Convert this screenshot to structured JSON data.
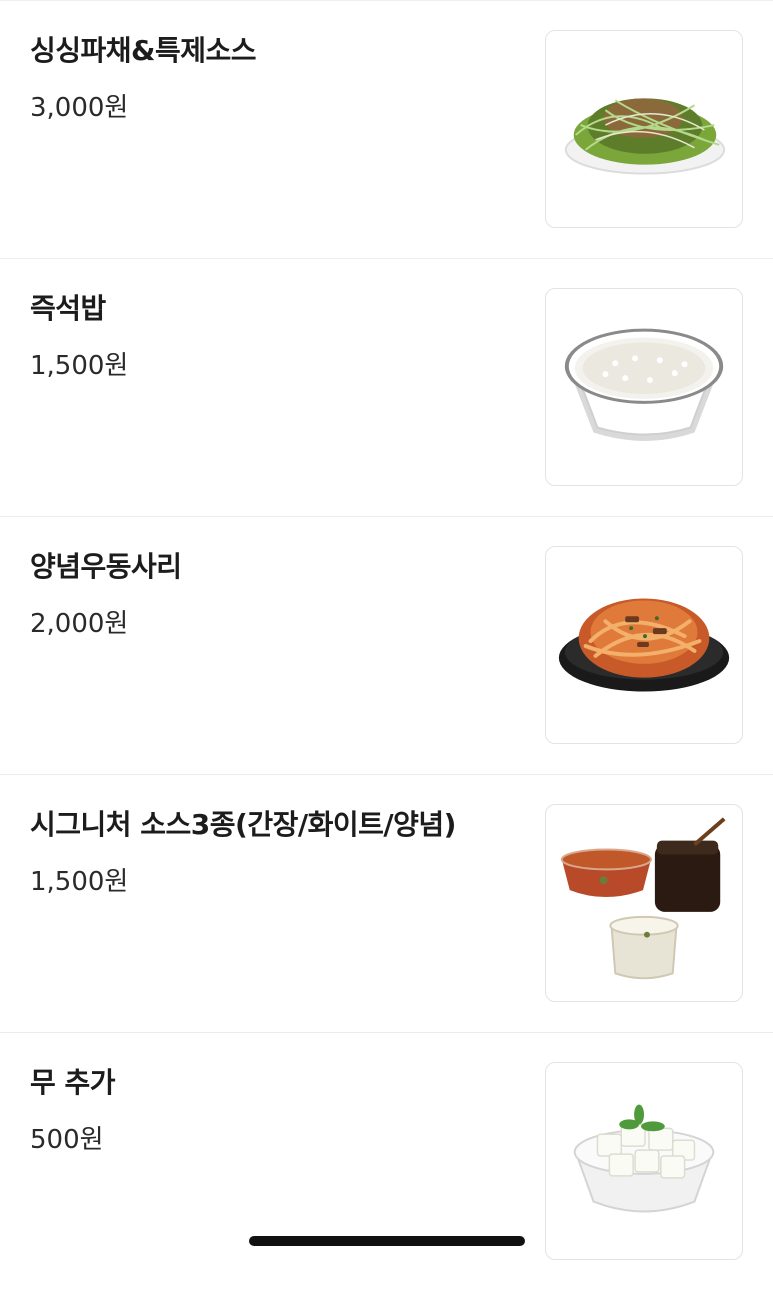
{
  "items": [
    {
      "name": "싱싱파채&특제소스",
      "price": "3,000원",
      "image": "green-onion-salad-image"
    },
    {
      "name": "즉석밥",
      "price": "1,500원",
      "image": "instant-rice-image"
    },
    {
      "name": "양념우동사리",
      "price": "2,000원",
      "image": "seasoned-udon-image"
    },
    {
      "name": "시그니처 소스3종(간장/화이트/양념)",
      "price": "1,500원",
      "image": "signature-sauces-image"
    },
    {
      "name": "무 추가",
      "price": "500원",
      "image": "pickled-radish-image"
    }
  ]
}
